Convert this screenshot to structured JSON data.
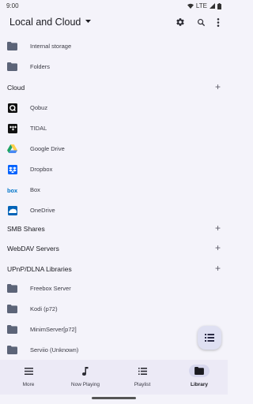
{
  "status_bar": {
    "time": "9:00",
    "network": "LTE"
  },
  "app_bar": {
    "title": "Local and Cloud",
    "actions": [
      "gear-icon",
      "search-icon",
      "more-vert-icon"
    ]
  },
  "local": [
    {
      "label": "Internal storage",
      "icon": "folder-icon"
    },
    {
      "label": "Folders",
      "icon": "folder-icon"
    }
  ],
  "sections": {
    "cloud": "Cloud",
    "smb": "SMB Shares",
    "webdav": "WebDAV Servers",
    "upnp": "UPnP/DLNA Libraries"
  },
  "cloud_items": [
    {
      "label": "Qobuz",
      "icon": "qobuz-icon"
    },
    {
      "label": "TIDAL",
      "icon": "tidal-icon"
    },
    {
      "label": "Google Drive",
      "icon": "google-drive-icon"
    },
    {
      "label": "Dropbox",
      "icon": "dropbox-icon"
    },
    {
      "label": "Box",
      "icon": "box-icon"
    },
    {
      "label": "OneDrive",
      "icon": "onedrive-icon"
    }
  ],
  "upnp_items": [
    {
      "label": "Freebox Server",
      "icon": "folder-icon"
    },
    {
      "label": "Kodi (p72)",
      "icon": "folder-icon"
    },
    {
      "label": "MinimServer[p72]",
      "icon": "folder-icon"
    },
    {
      "label": "Serviio (Unknown)",
      "icon": "folder-icon"
    }
  ],
  "fab": {
    "icon": "queue-list-icon"
  },
  "bottom_nav": [
    {
      "label": "More",
      "icon": "menu-icon",
      "active": false
    },
    {
      "label": "Now Playing",
      "icon": "music-note-icon",
      "active": false
    },
    {
      "label": "Playlist",
      "icon": "playlist-icon",
      "active": false
    },
    {
      "label": "Library",
      "icon": "folder-icon",
      "active": true
    }
  ],
  "colors": {
    "background": "#f4f3fa",
    "folder": "#5c6478",
    "active_pill": "#d8d8ee",
    "google_green": "#1fa463",
    "google_yellow": "#ffd04b",
    "google_blue": "#4688f4",
    "dropbox_blue": "#0061fe",
    "box_blue": "#0075c9",
    "onedrive_blue": "#0364b8"
  }
}
